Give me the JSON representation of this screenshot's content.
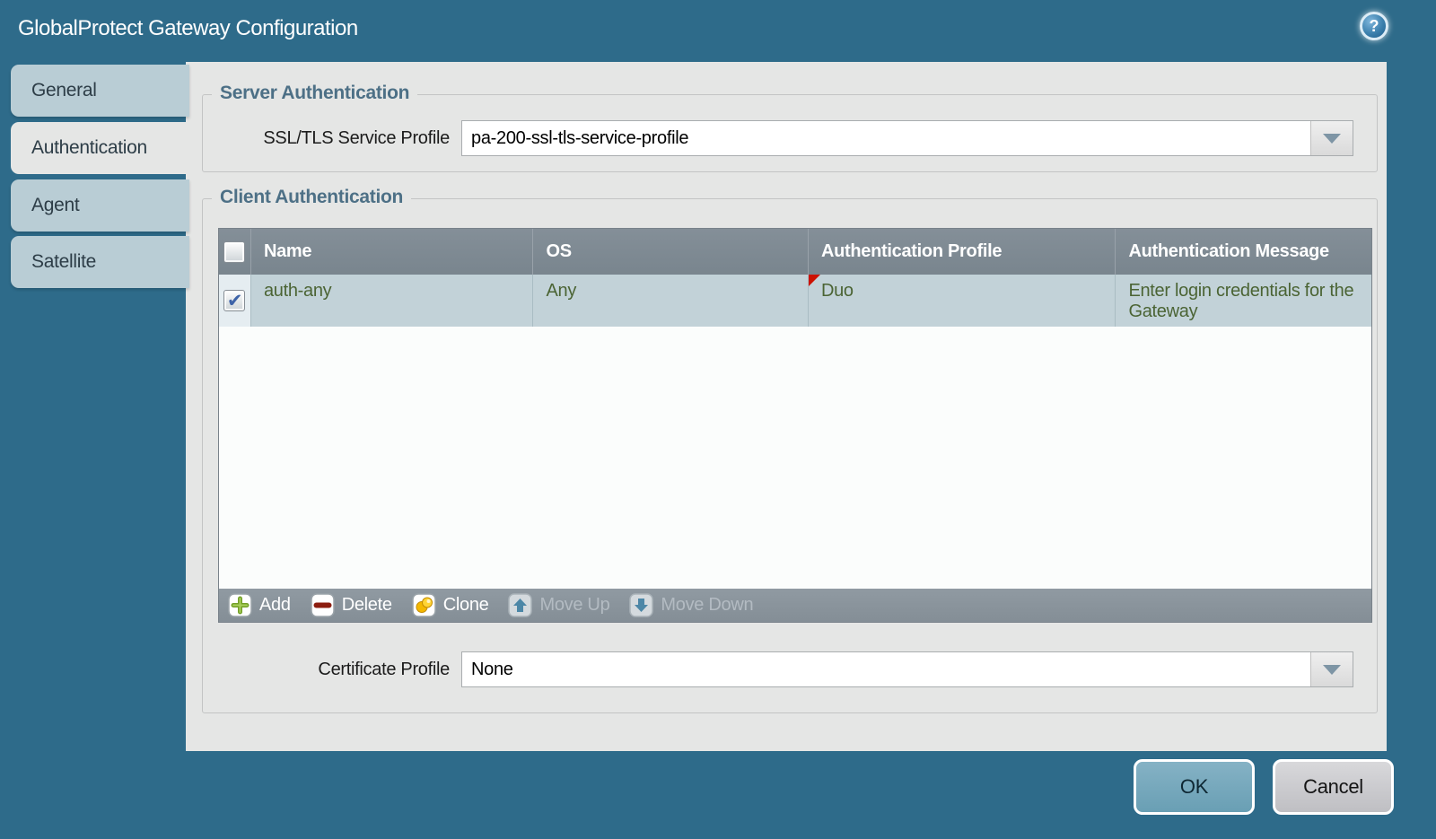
{
  "window": {
    "title": "GlobalProtect Gateway Configuration"
  },
  "icons": {
    "help": "?",
    "checkmark": "✔"
  },
  "sidebar": {
    "tabs": [
      {
        "label": "General",
        "active": false
      },
      {
        "label": "Authentication",
        "active": true
      },
      {
        "label": "Agent",
        "active": false
      },
      {
        "label": "Satellite",
        "active": false
      }
    ]
  },
  "server_auth": {
    "legend": "Server Authentication",
    "ssl_label": "SSL/TLS Service Profile",
    "ssl_value": "pa-200-ssl-tls-service-profile"
  },
  "client_auth": {
    "legend": "Client Authentication",
    "table": {
      "columns": [
        "Name",
        "OS",
        "Authentication Profile",
        "Authentication Message"
      ],
      "rows": [
        {
          "checked": true,
          "name": "auth-any",
          "os": "Any",
          "profile": "Duo",
          "profile_modified": true,
          "message": "Enter login credentials for the Gateway"
        }
      ]
    },
    "toolbar": [
      {
        "label": "Add",
        "enabled": true
      },
      {
        "label": "Delete",
        "enabled": true
      },
      {
        "label": "Clone",
        "enabled": true
      },
      {
        "label": "Move Up",
        "enabled": false
      },
      {
        "label": "Move Down",
        "enabled": false
      }
    ],
    "cert_label": "Certificate Profile",
    "cert_value": "None"
  },
  "footer": {
    "ok_label": "OK",
    "cancel_label": "Cancel"
  },
  "colors": {
    "background_teal": "#2e6b8a",
    "panel_gray": "#e5e6e5",
    "tab_inactive": "#b9cdd5",
    "legend_blue": "#4d7086",
    "table_header_gray": "#7d8b94",
    "row_blue_gray": "#c2d2d8",
    "row_text_green": "#4b6434",
    "toolbar_gray": "#8a939b",
    "modified_marker_red": "#cc1100",
    "ok_button_blue": "#6ea3ba",
    "cancel_button_gray": "#c6c6ca"
  }
}
